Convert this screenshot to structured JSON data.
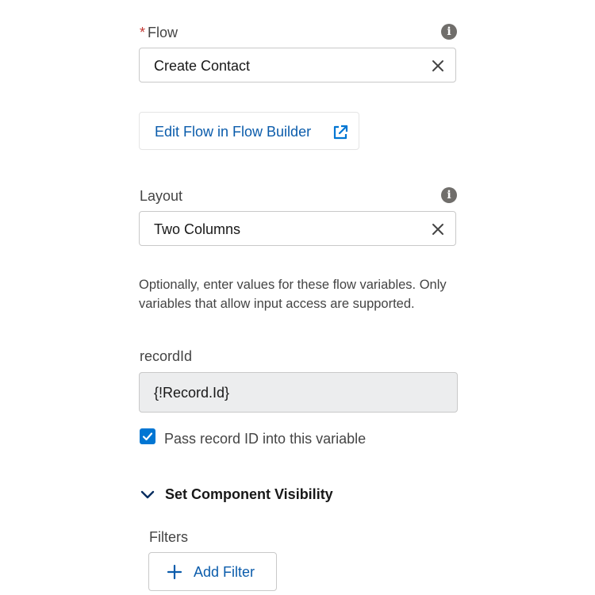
{
  "flow_field": {
    "required_marker": "*",
    "label": "Flow",
    "value": "Create Contact",
    "info_icon": "info-icon",
    "clear_icon": "close-icon"
  },
  "edit_flow": {
    "label": "Edit Flow in Flow Builder",
    "icon": "external-link-icon"
  },
  "layout_field": {
    "label": "Layout",
    "value": "Two Columns",
    "info_icon": "info-icon",
    "clear_icon": "close-icon"
  },
  "variables_help": "Optionally, enter values for these flow variables. Only variables that allow input access are supported.",
  "record_id_field": {
    "label": "recordId",
    "value": "{!Record.Id}"
  },
  "pass_record_id": {
    "checked": true,
    "label": "Pass record ID into this variable"
  },
  "visibility_section": {
    "title": "Set Component Visibility",
    "expanded": true,
    "filters_label": "Filters",
    "add_filter_label": "Add Filter"
  },
  "colors": {
    "link_blue": "#0b5cab",
    "checkbox_blue": "#0176d3",
    "required_red": "#c23934",
    "readonly_bg": "#ecedee",
    "border": "#c9c9c9"
  }
}
